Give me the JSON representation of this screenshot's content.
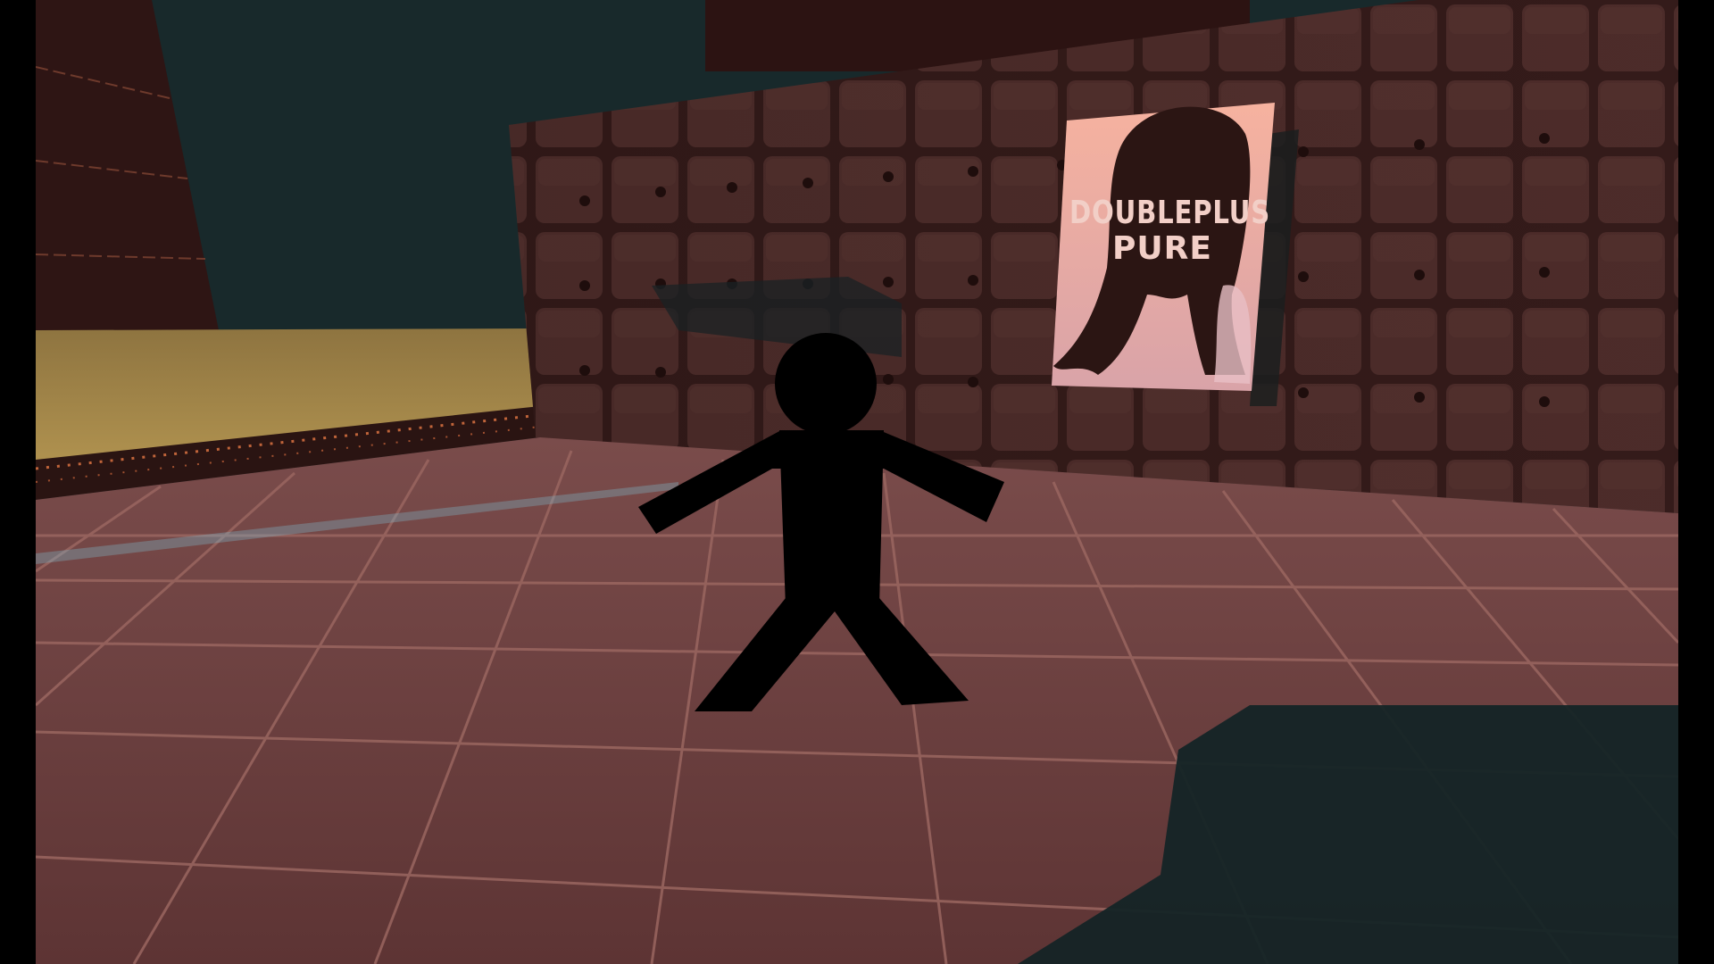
{
  "game": {
    "view": "first-person",
    "letterbox": "pillarbox",
    "poster": {
      "line1": "DOUBLEPLUS",
      "line2": "PURE"
    },
    "colors": {
      "sky": "#18292b",
      "floor_tile": "#6b3f3f",
      "floor_grout": "#8a5a55",
      "wall_tile": "#4a2a28",
      "wall_grout": "#2a1413",
      "sand": "#a88a4c",
      "shadow": "#142426",
      "poster_bg": "#f4b0a0",
      "hair": "#2a1513",
      "figure": "#000000"
    }
  }
}
